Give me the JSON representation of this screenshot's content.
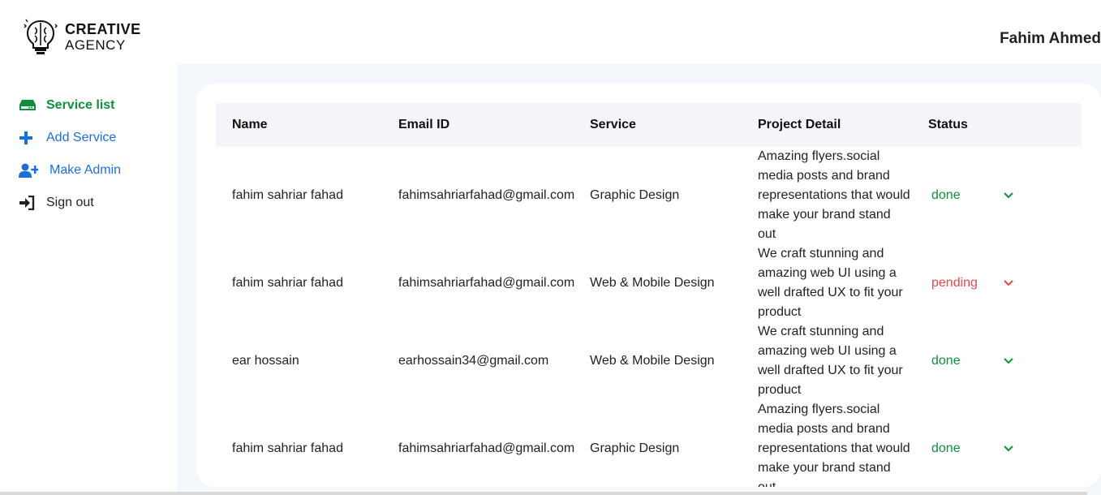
{
  "brand": {
    "line1": "CREATIVE",
    "line2": "AGENCY"
  },
  "user": {
    "name": "Fahim Ahmed"
  },
  "sidebar": {
    "items": [
      {
        "label": "Service list",
        "icon": "hdd-icon"
      },
      {
        "label": "Add Service",
        "icon": "plus-icon"
      },
      {
        "label": "Make Admin",
        "icon": "user-plus-icon"
      },
      {
        "label": "Sign out",
        "icon": "sign-out-icon"
      }
    ]
  },
  "table": {
    "headers": [
      "Name",
      "Email ID",
      "Service",
      "Project Detail",
      "Status"
    ],
    "rows": [
      {
        "name": "fahim sahriar fahad",
        "email": "fahimsahriarfahad@gmail.com",
        "service": "Graphic Design",
        "detail": [
          "Amazing flyers.social",
          "media posts and brand",
          "representations that would",
          "make your brand stand",
          "out"
        ],
        "status": "done"
      },
      {
        "name": "fahim sahriar fahad",
        "email": "fahimsahriarfahad@gmail.com",
        "service": "Web & Mobile Design",
        "detail": [
          "We craft stunning and",
          "amazing web UI using a",
          "well drafted UX to fit your",
          "product"
        ],
        "status": "pending"
      },
      {
        "name": "ear hossain",
        "email": "earhossain34@gmail.com",
        "service": "Web & Mobile Design",
        "detail": [
          "We craft stunning and",
          "amazing web UI using a",
          "well drafted UX to fit your",
          "product"
        ],
        "status": "done"
      },
      {
        "name": "fahim sahriar fahad",
        "email": "fahimsahriarfahad@gmail.com",
        "service": "Graphic Design",
        "detail": [
          "Amazing flyers.social",
          "media posts and brand",
          "representations that would",
          "make your brand stand",
          "out"
        ],
        "status": "done"
      }
    ]
  },
  "colors": {
    "active": "#0f8f3e",
    "link": "#1d6fd8",
    "done": "#0f8f3e",
    "pending": "#e44848",
    "panel": "#f4f7fc"
  }
}
